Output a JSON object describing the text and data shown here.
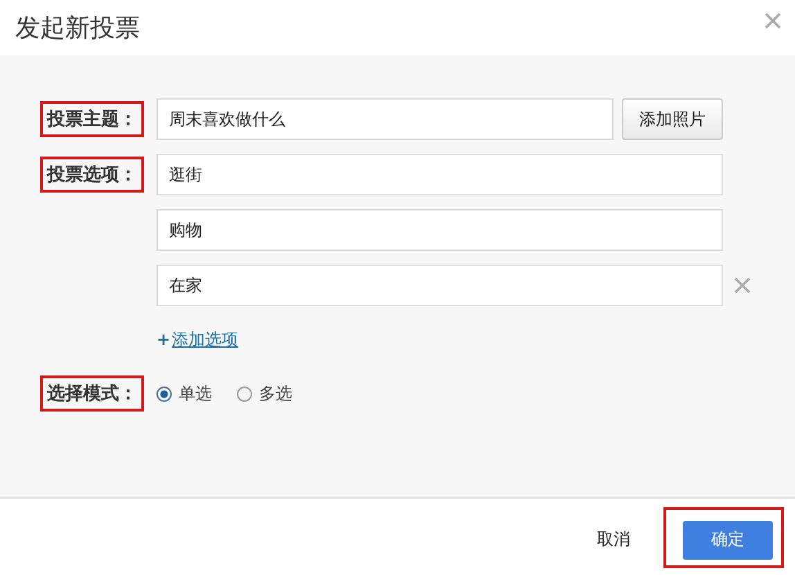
{
  "dialog": {
    "title": "发起新投票"
  },
  "topic": {
    "label": "投票主题：",
    "highlighted": true,
    "value": "周末喜欢做什么",
    "photo_button": "添加照片"
  },
  "options": {
    "label": "投票选项：",
    "highlighted": true,
    "items": [
      {
        "value": "逛街",
        "removable": false
      },
      {
        "value": "购物",
        "removable": false
      },
      {
        "value": "在家",
        "removable": true
      }
    ],
    "add_link": "添加选项",
    "add_icon": "+"
  },
  "mode": {
    "label": "选择模式：",
    "highlighted": true,
    "choices": [
      {
        "label": "单选",
        "selected": true
      },
      {
        "label": "多选",
        "selected": false
      }
    ]
  },
  "footer": {
    "buttons": [
      {
        "label": "取消",
        "kind": "plain",
        "highlighted": false
      },
      {
        "label": "确定",
        "kind": "primary",
        "highlighted": true
      }
    ]
  }
}
